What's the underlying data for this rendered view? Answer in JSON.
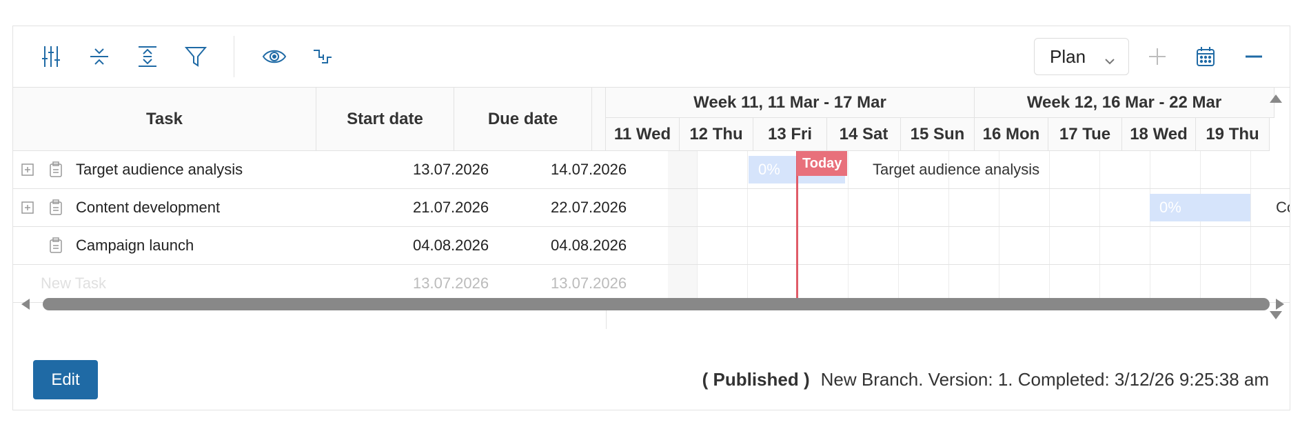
{
  "toolbar": {
    "icons": [
      "sliders-icon",
      "collapse-icon",
      "expand-icon",
      "filter-icon",
      "eye-icon",
      "dependency-icon"
    ],
    "view_select": "Plan",
    "add_icon": "plus-icon",
    "calendar_icon": "calendar-icon",
    "zoom_out_icon": "minus-icon"
  },
  "columns": {
    "task": "Task",
    "start": "Start date",
    "due": "Due date"
  },
  "timeline": {
    "weeks": [
      "Week 11, 11 Mar - 17 Mar",
      "Week 12, 16 Mar - 22 Mar"
    ],
    "days": [
      "11 Wed",
      "12 Thu",
      "13 Fri",
      "14 Sat",
      "15 Sun",
      "16 Mon",
      "17 Tue",
      "18 Wed",
      "19 Thu"
    ],
    "today_label": "Today"
  },
  "tasks": [
    {
      "name": "Target audience analysis",
      "start": "13.07.2026",
      "due": "14.07.2026",
      "progress": "0%",
      "bar_label": "Target audience analysis"
    },
    {
      "name": "Content development",
      "start": "21.07.2026",
      "due": "22.07.2026",
      "progress": "0%",
      "bar_label": "Co"
    },
    {
      "name": "Campaign launch",
      "start": "04.08.2026",
      "due": "04.08.2026"
    }
  ],
  "new_task": {
    "name": "New Task",
    "start": "13.07.2026",
    "due": "13.07.2026"
  },
  "footer": {
    "edit_label": "Edit",
    "status_published": "( Published )",
    "status_text": "New Branch. Version: 1. Completed: 3/12/26 9:25:38 am"
  },
  "colors": {
    "accent": "#1f6aa5",
    "today": "#e05b68",
    "bar": "#d6e4fb"
  }
}
